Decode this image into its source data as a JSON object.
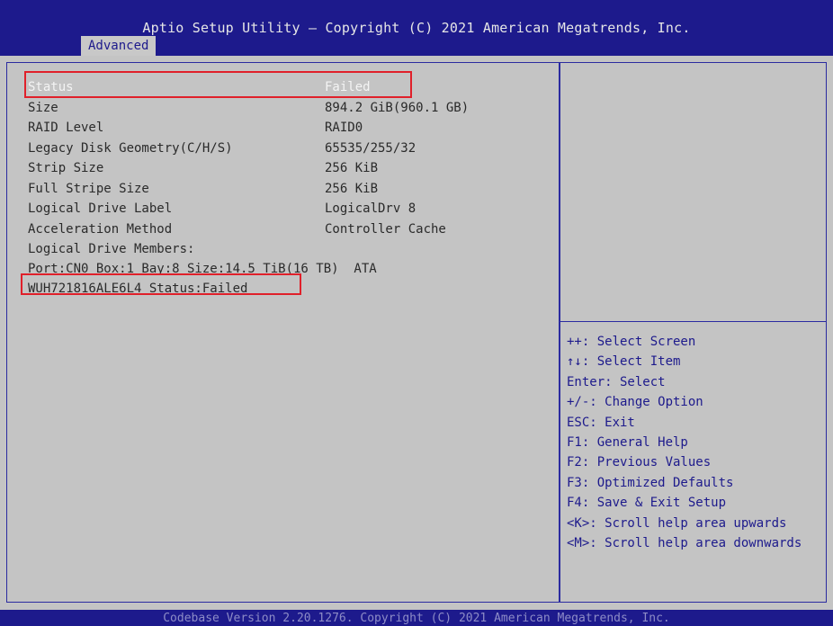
{
  "header": {
    "title": "Aptio Setup Utility – Copyright (C) 2021 American Megatrends, Inc.",
    "tab": "Advanced"
  },
  "details": [
    {
      "label": "Status",
      "value": "Failed"
    },
    {
      "label": "Size",
      "value": "894.2 GiB(960.1 GB)"
    },
    {
      "label": "RAID Level",
      "value": "RAID0"
    },
    {
      "label": "Legacy Disk Geometry(C/H/S)",
      "value": "65535/255/32"
    },
    {
      "label": "Strip Size",
      "value": "256 KiB"
    },
    {
      "label": "Full Stripe Size",
      "value": "256 KiB"
    },
    {
      "label": "Logical Drive Label",
      "value": "LogicalDrv 8"
    },
    {
      "label": "Acceleration Method",
      "value": "Controller Cache"
    }
  ],
  "members": {
    "heading": "Logical Drive Members:",
    "port_line": "Port:CN0 Box:1 Bay:8 Size:14.5 TiB(16 TB)  ATA",
    "drive_status": "WUH721816ALE6L4 Status:Failed"
  },
  "help": [
    {
      "text": "++: Select Screen"
    },
    {
      "text": "↑↓: Select Item"
    },
    {
      "text": "Enter: Select"
    },
    {
      "text": "+/-: Change Option"
    },
    {
      "text": "ESC: Exit"
    },
    {
      "text": "F1: General Help"
    },
    {
      "text": "F2: Previous Values"
    },
    {
      "text": "F3: Optimized Defaults"
    },
    {
      "text": "F4: Save & Exit Setup"
    },
    {
      "text": "<K>: Scroll help area upwards"
    },
    {
      "text": "<M>: Scroll help area downwards"
    }
  ],
  "footer": {
    "text": "Codebase Version 2.20.1276. Copyright (C) 2021 American Megatrends, Inc."
  },
  "colors": {
    "bar_blue": "#1d1a8c",
    "panel_gray": "#c4c4c4",
    "highlight_red": "#e0202a"
  }
}
